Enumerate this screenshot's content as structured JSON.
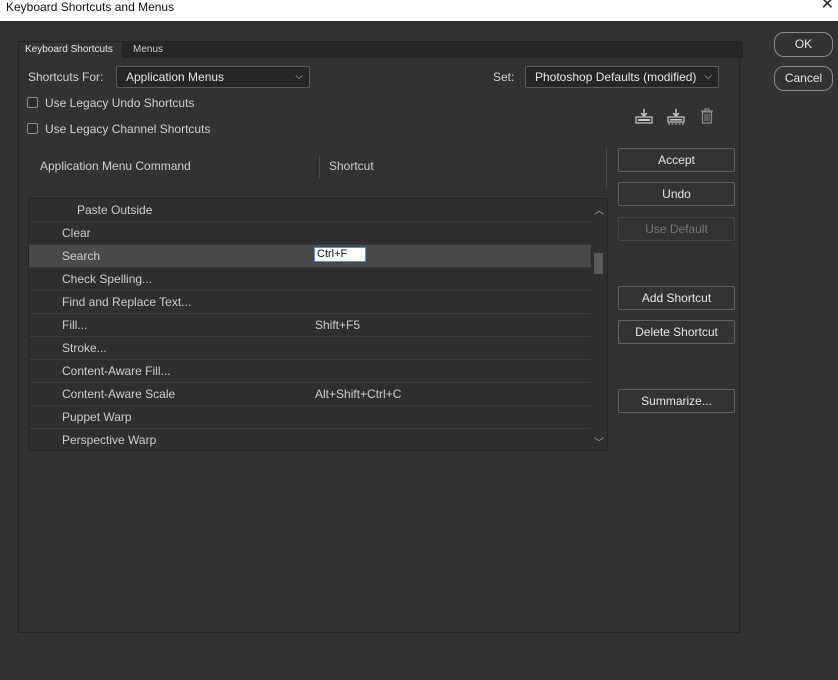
{
  "window": {
    "title": "Keyboard Shortcuts and Menus",
    "close_icon": "close-icon"
  },
  "tabs": [
    {
      "label": "Keyboard Shortcuts",
      "active": true
    },
    {
      "label": "Menus",
      "active": false
    }
  ],
  "shortcuts_for": {
    "label": "Shortcuts For:",
    "value": "Application Menus"
  },
  "set": {
    "label": "Set:",
    "value": "Photoshop Defaults (modified)"
  },
  "checkboxes": [
    {
      "label": "Use Legacy Undo Shortcuts",
      "checked": false
    },
    {
      "label": "Use Legacy Channel Shortcuts",
      "checked": false
    }
  ],
  "set_icons": [
    "save-set-icon",
    "save-set-as-icon",
    "delete-set-icon"
  ],
  "table": {
    "columns": [
      "Application Menu Command",
      "Shortcut"
    ],
    "rows": [
      {
        "command": "Paste Outside",
        "shortcut": ""
      },
      {
        "command": "Clear",
        "shortcut": ""
      },
      {
        "command": "Search",
        "shortcut": "Ctrl+F"
      },
      {
        "command": "Check Spelling...",
        "shortcut": ""
      },
      {
        "command": "Find and Replace Text...",
        "shortcut": ""
      },
      {
        "command": "Fill...",
        "shortcut": "Shift+F5"
      },
      {
        "command": "Stroke...",
        "shortcut": ""
      },
      {
        "command": "Content-Aware Fill...",
        "shortcut": ""
      },
      {
        "command": "Content-Aware Scale",
        "shortcut": "Alt+Shift+Ctrl+C"
      },
      {
        "command": "Puppet Warp",
        "shortcut": ""
      },
      {
        "command": "Perspective Warp",
        "shortcut": ""
      }
    ]
  },
  "side_buttons": {
    "accept": "Accept",
    "undo": "Undo",
    "use_default": "Use Default",
    "add_shortcut": "Add Shortcut",
    "delete_shortcut": "Delete Shortcut",
    "summarize": "Summarize..."
  },
  "dialog_buttons": {
    "ok": "OK",
    "cancel": "Cancel"
  },
  "colors": {
    "background": "#323232",
    "selected_row": "#494949",
    "edit_field": "#ffffff"
  }
}
